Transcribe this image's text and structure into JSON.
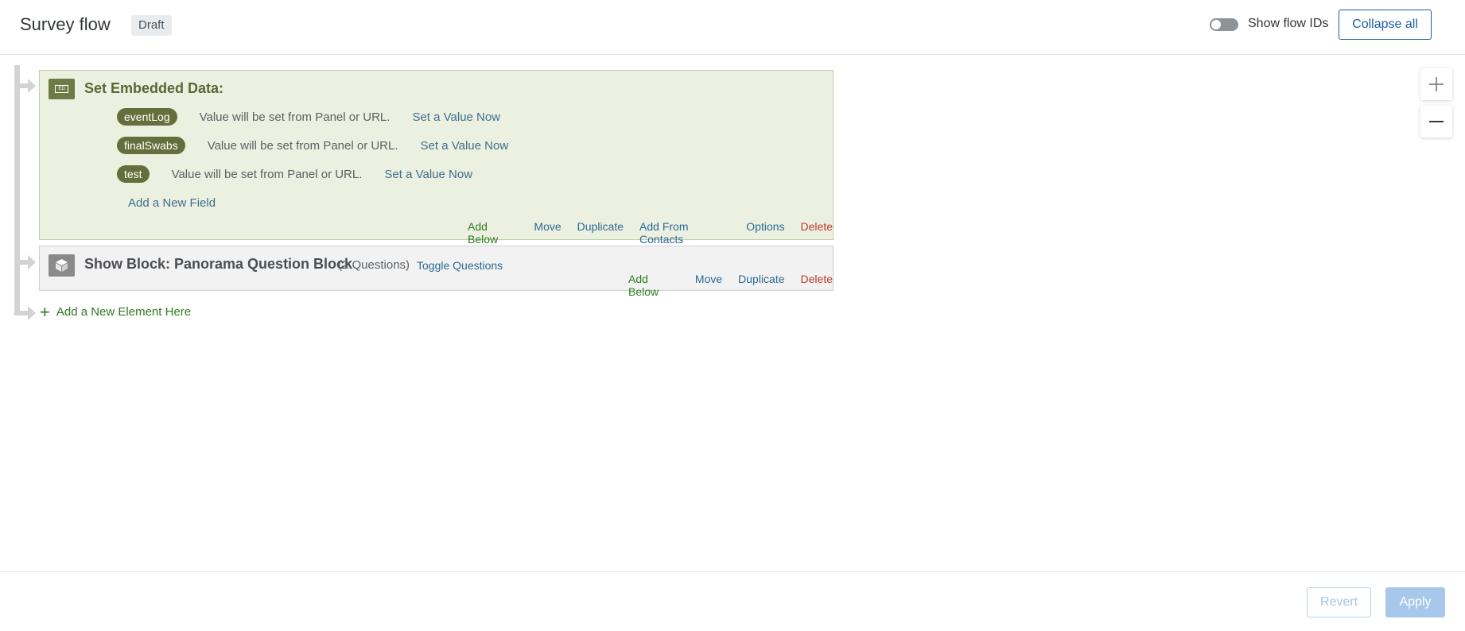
{
  "header": {
    "title": "Survey flow",
    "status_badge": "Draft",
    "show_ids_label": "Show flow IDs",
    "show_ids_on": false,
    "collapse_label": "Collapse all"
  },
  "embedded_block": {
    "icon_text": "ED",
    "title": "Set Embedded Data:",
    "fields": [
      {
        "name": "eventLog",
        "description": "Value will be set from Panel or URL.",
        "link": "Set a Value Now"
      },
      {
        "name": "finalSwabs",
        "description": "Value will be set from Panel or URL.",
        "link": "Set a Value Now"
      },
      {
        "name": "test",
        "description": "Value will be set from Panel or URL.",
        "link": "Set a Value Now"
      }
    ],
    "add_field": "Add a New Field",
    "actions": {
      "add_below": "Add Below",
      "move": "Move",
      "duplicate": "Duplicate",
      "add_from_contacts": "Add From Contacts",
      "options": "Options",
      "delete": "Delete"
    }
  },
  "show_block": {
    "title": "Show Block: Panorama Question Block",
    "count": "(2 Questions)",
    "toggle": "Toggle Questions",
    "actions": {
      "add_below": "Add Below",
      "move": "Move",
      "duplicate": "Duplicate",
      "delete": "Delete"
    }
  },
  "add_element": "Add a New Element Here",
  "zoom": {
    "in_icon": "plus-icon",
    "out_icon": "minus-icon"
  },
  "footer": {
    "revert": "Revert",
    "apply": "Apply"
  },
  "colors": {
    "embedded_bg": "#ebf0e0",
    "embedded_accent": "#666e3c",
    "link_blue": "#3e6f8f",
    "action_green": "#2d7a22",
    "delete_red": "#c0392b",
    "primary_blue": "#1a5ca7"
  }
}
